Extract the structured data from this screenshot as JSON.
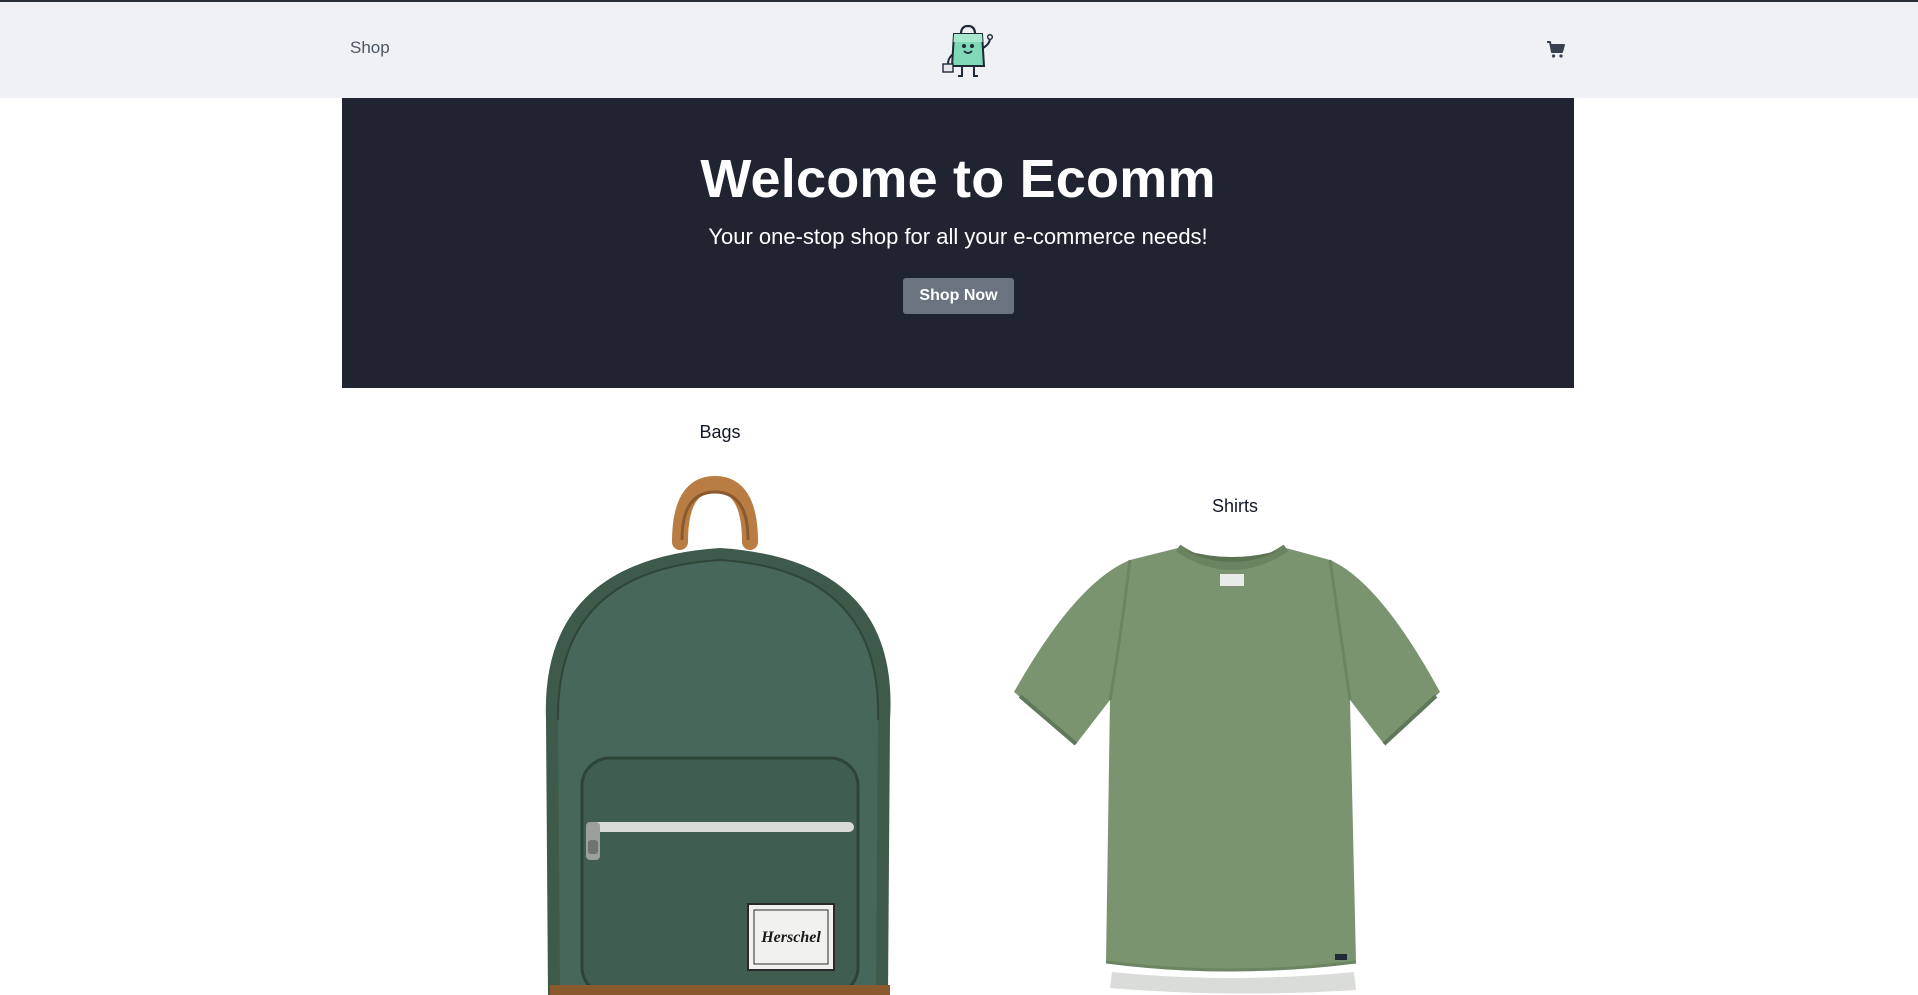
{
  "header": {
    "nav_shop_label": "Shop",
    "logo_icon": "shopping-bag-mascot-icon",
    "cart_icon": "cart-icon"
  },
  "hero": {
    "title": "Welcome to Ecomm",
    "subtitle": "Your one-stop shop for all your e-commerce needs!",
    "cta_label": "Shop Now"
  },
  "categories": [
    {
      "title": "Bags",
      "image_icon": "backpack-image",
      "badge_text": "Herschel"
    },
    {
      "title": "Shirts",
      "image_icon": "tshirt-image"
    }
  ],
  "colors": {
    "header_bg": "#f0f1f4",
    "hero_bg": "#1f2430",
    "button_bg": "#6b7280",
    "bag_green": "#3e5a4b",
    "shirt_green": "#7a9470"
  }
}
